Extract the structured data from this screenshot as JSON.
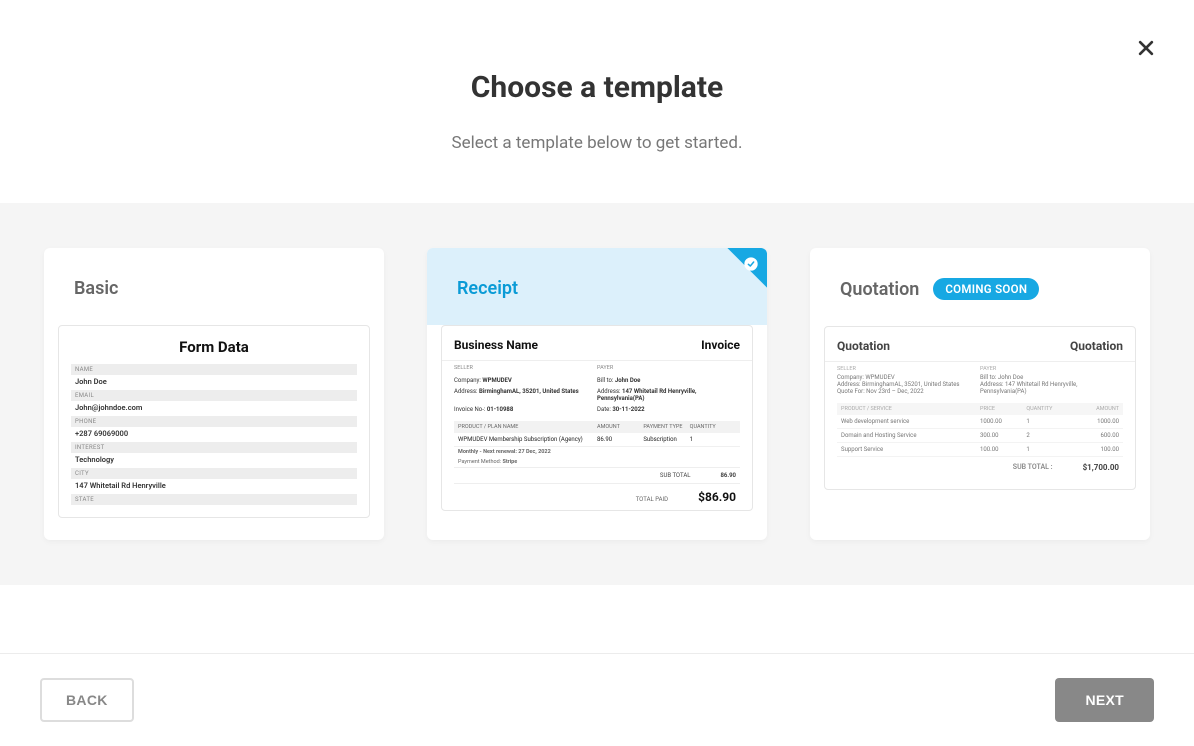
{
  "header": {
    "title": "Choose a template",
    "subtitle": "Select a template below to get started."
  },
  "footer": {
    "back_label": "BACK",
    "next_label": "NEXT"
  },
  "badges": {
    "coming_soon": "COMING SOON"
  },
  "templates": {
    "basic": {
      "title": "Basic",
      "preview_title": "Form Data",
      "fields": [
        {
          "label": "NAME",
          "value": "John Doe"
        },
        {
          "label": "EMAIL",
          "value": "John@johndoe.com"
        },
        {
          "label": "PHONE",
          "value": "+287 69069000"
        },
        {
          "label": "INTEREST",
          "value": "Technology"
        },
        {
          "label": "CITY",
          "value": "147 Whitetail Rd Henryville"
        },
        {
          "label": "STATE",
          "value": ""
        }
      ]
    },
    "receipt": {
      "title": "Receipt",
      "selected": true,
      "business_name": "Business Name",
      "heading": "Invoice",
      "seller_label": "SELLER",
      "payer_label": "PAYER",
      "company_label": "Company:",
      "company_value": "WPMUDEV",
      "bill_to_label": "Bill to:",
      "bill_to_value": "John Doe",
      "seller_address_label": "Address:",
      "seller_address_value": "BirminghamAL, 35201, United States",
      "payer_address_label": "Address:",
      "payer_address_value": "147 Whitetail Rd Henryville, Pennsylvania(PA)",
      "invoice_no_label": "Invoice No-:",
      "invoice_no_value": "01-10988",
      "date_label": "Date:",
      "date_value": "30-11-2022",
      "columns": {
        "product": "PRODUCT / PLAN NAME",
        "amount": "AMOUNT",
        "payment": "PAYMENT TYPE",
        "qty": "QUANTITY"
      },
      "row": {
        "product": "WPMUDEV Membership Subscription (Agency)",
        "amount": "86.90",
        "payment": "Subscription",
        "qty": "1"
      },
      "schedule": "Monthly - Next renewal: 27 Dec, 2022",
      "payment_method_label": "Payment Method:",
      "payment_method_value": "Stripe",
      "subtotal_label": "SUB TOTAL",
      "subtotal_value": "86.90",
      "total_label": "TOTAL PAID",
      "total_value": "$86.90"
    },
    "quotation": {
      "title": "Quotation",
      "heading_left": "Quotation",
      "heading_right": "Quotation",
      "seller_label": "SELLER",
      "payer_label": "PAYER",
      "company_label": "Company:",
      "company_value": "WPMUDEV",
      "bill_to_label": "Bill to:",
      "bill_to_value": "John Doe",
      "seller_address_label": "Address:",
      "seller_address_value": "BirminghamAL, 35201, United States",
      "payer_address_label": "Address:",
      "payer_address_value": "147 Whitetail Rd Henryville, Pennsylvania(PA)",
      "valid_label": "Quote For:",
      "valid_value": "Nov 23rd – Dec, 2022",
      "columns": {
        "product": "PRODUCT / SERVICE",
        "price": "PRICE",
        "qty": "QUANTITY",
        "amount": "AMOUNT"
      },
      "rows": [
        {
          "product": "Web development service",
          "price": "1000.00",
          "qty": "1",
          "amount": "1000.00"
        },
        {
          "product": "Domain and Hosting Service",
          "price": "300.00",
          "qty": "2",
          "amount": "600.00"
        },
        {
          "product": "Support Service",
          "price": "100.00",
          "qty": "1",
          "amount": "100.00"
        }
      ],
      "subtotal_label": "SUB TOTAL :",
      "subtotal_value": "$1,700.00"
    }
  }
}
